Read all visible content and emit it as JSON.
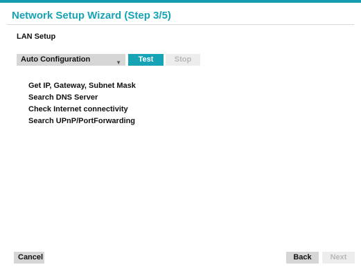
{
  "wizard": {
    "title": "Network Setup Wizard (Step 3/5)",
    "section_label": "LAN Setup"
  },
  "config": {
    "mode_selected": "Auto Configuration",
    "test_label": "Test",
    "stop_label": "Stop"
  },
  "steps": [
    "Get IP, Gateway, Subnet Mask",
    "Search DNS Server",
    "Check Internet connectivity",
    "Search UPnP/PortForwarding"
  ],
  "footer": {
    "cancel_label": "Cancel",
    "back_label": "Back",
    "next_label": "Next"
  },
  "colors": {
    "accent": "#16a3b6",
    "disabled_text": "#b8b8b8",
    "button_bg": "#d6d6d6"
  },
  "icons": {
    "dropdown": "chevron-down-icon"
  }
}
